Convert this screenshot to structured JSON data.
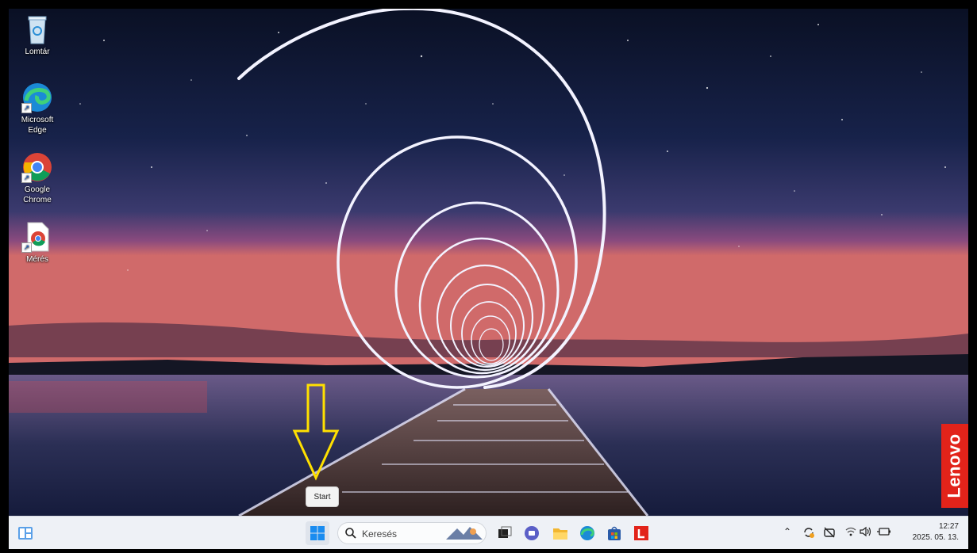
{
  "desktop": {
    "icons": [
      {
        "label": "Lomtár",
        "icon": "recycle-bin-icon"
      },
      {
        "label": "Microsoft Edge",
        "icon": "edge-icon"
      },
      {
        "label": "Google Chrome",
        "icon": "chrome-icon"
      },
      {
        "label": "Mérés",
        "icon": "chrome-document-icon"
      }
    ],
    "brand_tag": "Lenovo",
    "tooltip": "Start"
  },
  "taskbar": {
    "search_placeholder": "Keresés",
    "apps": [
      "widgets-icon",
      "start-icon",
      "task-view-icon",
      "teams-icon",
      "file-explorer-icon",
      "edge-icon",
      "store-icon",
      "lenovo-app-icon"
    ],
    "clock_time": "12:27",
    "clock_date": "2025. 05. 13."
  },
  "colors": {
    "accent": "#0067c0",
    "lenovo_red": "#e2231a",
    "annotation": "#ffe000"
  }
}
